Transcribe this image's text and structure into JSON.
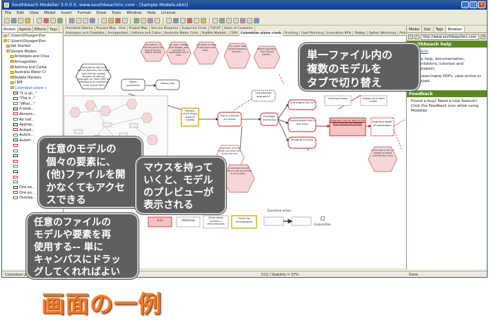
{
  "window": {
    "title": "Southbeach Modeller 3.0.0.0, www.southbeachinc.com - [Sample Models.sbm]",
    "menu": [
      "File",
      "Edit",
      "View",
      "Model",
      "Insert",
      "Format",
      "Draw",
      "Tools",
      "Window",
      "Help",
      "License"
    ]
  },
  "left_panel": {
    "tabs": [
      "Models",
      "Agents",
      "Effects",
      "Tags"
    ],
    "tree": [
      "C:\\Users\\Ohyagor\\Doc",
      "C:\\Users\\Ohyagor\\Doc",
      "Get Started",
      "Sample Models",
      "Antelopes and Chea",
      "Armageddon",
      "Asthma and Calise",
      "Australia Water Cr",
      "Bubble Markets",
      "CRM",
      "Columbian plane c",
      "\"It is all...\"",
      "\"The b...\"",
      "\"What...\"",
      "A boxe...",
      "Abnorm...",
      "Air traf...",
      "Approp...",
      "Autopil...",
      "Autom...",
      "Autom...",
      "",
      "",
      "",
      "",
      "",
      "",
      "",
      "",
      "One ae...",
      "One en...",
      "Overwa..."
    ]
  },
  "tabs": {
    "row1": [
      "President Obama",
      "Process Map - Risk",
      "Project Map",
      "Service Blueprint",
      "Subprime Crisis",
      "TOCAT",
      "Voice of Customer"
    ],
    "row2": [
      "Antelopes and Cheetahs",
      "Armageddon",
      "Asthma and Calise",
      "Australia Water Crisis",
      "Bubble Markets",
      "CRM",
      "Colombian plane crash",
      "Fracking",
      "Goal Planning",
      "Innovation KPIs",
      "iRobby",
      "Option Workshop",
      "Policy Engineering"
    ]
  },
  "diagram": {
    "hex_nodes": [
      "Uncertainty the local airline, Avianca, the plane had left the capital, Bogota, at around midnight on 0500 GMT on Monday and crashed at 2140 (0440 GMT)",
      "The Boeing 737 crashed due to the lack of the fuel before landing",
      "The flight, headed from Bogota, was carrying 73 passengers and 9 crew",
      "The death of three of the plane fuel were...",
      "Our Quest: Pilot ignored obvious hazards...",
      "Hazard Approach: Take Ground Control...",
      "Colombian airliner broke into three and burst into fuel",
      "A colombian airliner broke in half and landed at an airfield...",
      "All but one of the 131 people on board survived the crash"
    ],
    "rect_nodes": {
      "storm": "Storm conditions",
      "heavy_rain": "Heavy rain",
      "wheels": "Wheels stuck down short of runway",
      "low_altitude": "Low altitude approach?",
      "plane_crashed": "Plane crashed on island",
      "fuselage": "Fuselage fracturing",
      "one_engine": "One engine lips off",
      "flames": "Flames break out in one wing",
      "skidding": "Skidding on belly",
      "potential_risk": "Potential risk of loss of life and injuries for flames",
      "potential_death": "Potential death of passengers",
      "existing": "existing bushes",
      "engine_shut": "engine shut down action"
    },
    "legend": {
      "risk": "Risk",
      "potential": "Potential",
      "automated": "Automated actions / interventions",
      "focus": "Focus for investigation",
      "excessive": "Excessive action",
      "conjunction": "Conjunction"
    },
    "hexagon_note": "Illustration of using knowledge hexagons to...",
    "preview_minimap": "model preview"
  },
  "right_panel": {
    "tabs": [
      "Model",
      "Doc",
      "Tags",
      "Browser"
    ],
    "url": "http://www.southbeachinc.com",
    "help_title": "Southbeach help",
    "help_link": "Help wiki",
    "help_text1": "Online help, documentation, presentations, tutorials and whitepapers.",
    "help_text2": "Fully searchable PDFs, view online or download.",
    "feedback_title": "Feedback",
    "feedback_text": "Found a bug? Need a new feature? Click the Feedback icon while using Modeller."
  },
  "status_bar": {
    "left": "Colombian plane crash",
    "center": "7/12 / Stability = 37%",
    "right": "Done"
  },
  "callouts": {
    "top_right": "単一ファイル内の\n複数のモデルを\nタブで切り替え",
    "left_mid": "任意のモデルの\n個々の要素に、\n(他)ファイルを開\nかなくてもアクセ\nスできる",
    "center": "マウスを持って\nいくと、モデル\nのプレビューが\n表示される",
    "left_bottom": "任意のファイルの\nモデルや要素を再\n使用する-- 単に\nキャンバスにドラッ\nグしてくれればよい"
  },
  "footer_title": "画面の一例",
  "colors": {
    "risk_red": "#d43030",
    "hex_pink": "#f6d6d6",
    "focus_yellow": "#f2c531",
    "help_green": "#5b8a24",
    "title_orange": "#f07828"
  }
}
